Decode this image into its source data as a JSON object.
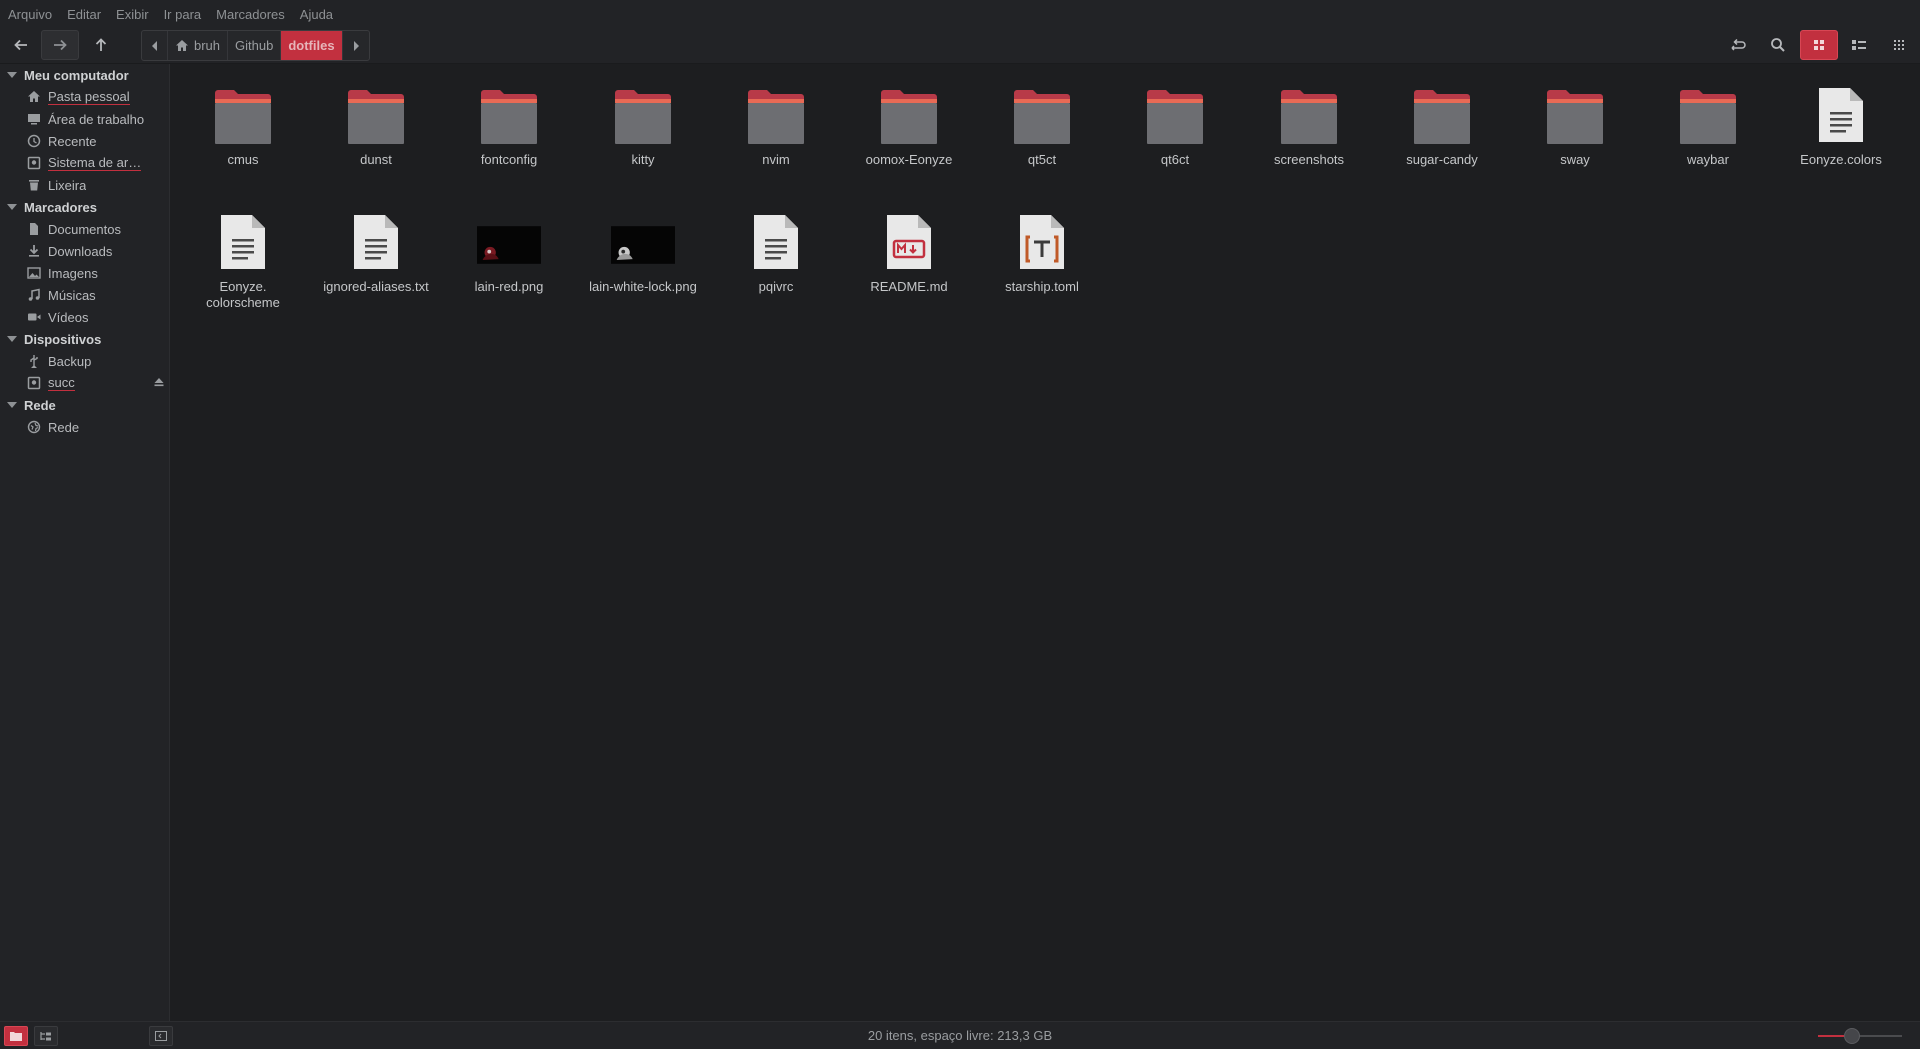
{
  "menu": [
    "Arquivo",
    "Editar",
    "Exibir",
    "Ir para",
    "Marcadores",
    "Ajuda"
  ],
  "path": [
    "bruh",
    "Github",
    "dotfiles"
  ],
  "sidebar": {
    "sections": [
      {
        "title": "Meu computador",
        "items": [
          {
            "label": "Pasta pessoal",
            "icon": "home-icon"
          },
          {
            "label": "Área de trabalho",
            "icon": "desktop-icon"
          },
          {
            "label": "Recente",
            "icon": "clock-icon"
          },
          {
            "label": "Sistema de ar…",
            "icon": "drive-icon"
          },
          {
            "label": "Lixeira",
            "icon": "trash-icon"
          }
        ]
      },
      {
        "title": "Marcadores",
        "items": [
          {
            "label": "Documentos",
            "icon": "document-icon"
          },
          {
            "label": "Downloads",
            "icon": "download-icon"
          },
          {
            "label": "Imagens",
            "icon": "image-icon"
          },
          {
            "label": "Músicas",
            "icon": "music-icon"
          },
          {
            "label": "Vídeos",
            "icon": "video-icon"
          }
        ]
      },
      {
        "title": "Dispositivos",
        "items": [
          {
            "label": "Backup",
            "icon": "usb-icon"
          },
          {
            "label": "succ",
            "icon": "drive-icon"
          }
        ]
      },
      {
        "title": "Rede",
        "items": [
          {
            "label": "Rede",
            "icon": "network-icon"
          }
        ]
      }
    ]
  },
  "files": [
    {
      "name": "cmus",
      "type": "folder"
    },
    {
      "name": "dunst",
      "type": "folder"
    },
    {
      "name": "fontconfig",
      "type": "folder"
    },
    {
      "name": "kitty",
      "type": "folder"
    },
    {
      "name": "nvim",
      "type": "folder"
    },
    {
      "name": "oomox-Eonyze",
      "type": "folder"
    },
    {
      "name": "qt5ct",
      "type": "folder"
    },
    {
      "name": "qt6ct",
      "type": "folder"
    },
    {
      "name": "screenshots",
      "type": "folder"
    },
    {
      "name": "sugar-candy",
      "type": "folder"
    },
    {
      "name": "sway",
      "type": "folder"
    },
    {
      "name": "waybar",
      "type": "folder"
    },
    {
      "name": "Eonyze.colors",
      "type": "text"
    },
    {
      "name": "Eonyze.\ncolorscheme",
      "type": "text"
    },
    {
      "name": "ignored-aliases.txt",
      "type": "text"
    },
    {
      "name": "lain-red.png",
      "type": "image-red"
    },
    {
      "name": "lain-white-lock.png",
      "type": "image-white"
    },
    {
      "name": "pqivrc",
      "type": "text"
    },
    {
      "name": "README.md",
      "type": "markdown"
    },
    {
      "name": "starship.toml",
      "type": "toml"
    }
  ],
  "status": {
    "text": "20 itens, espaço livre: 213,3 GB",
    "zoom_level": 0.4
  },
  "colors": {
    "accent": "#c2303f",
    "folder_body": "#6d6e72",
    "folder_tab": "#b83a48",
    "folder_stripe": "#e86a55"
  }
}
